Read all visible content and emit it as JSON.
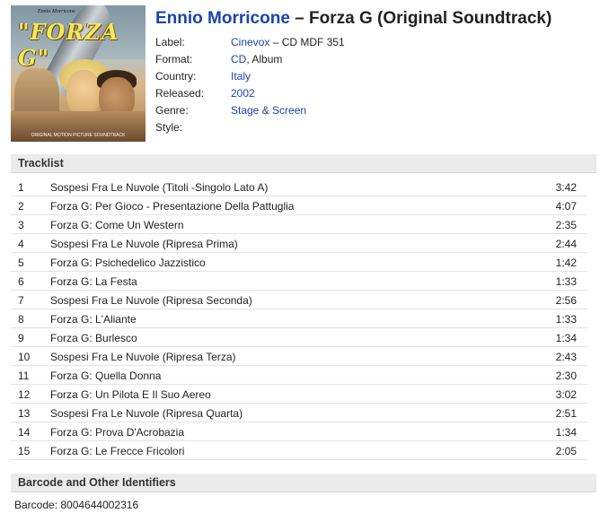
{
  "cover": {
    "artist_text": "Ennio Morricone",
    "title_text": "\"FORZA G\"",
    "caption_text": "ORIGINAL MOTION PICTURE SOUNDTRACK"
  },
  "release": {
    "artist": "Ennio Morricone",
    "separator": " – ",
    "title": "Forza G (Original Soundtrack)"
  },
  "meta": {
    "label_label": "Label:",
    "label_link": "Cinevox",
    "label_catalog": " – CD MDF 351",
    "format_label": "Format:",
    "format_link": "CD",
    "format_rest": ", Album",
    "country_label": "Country:",
    "country_value": "Italy",
    "released_label": "Released:",
    "released_value": "2002",
    "genre_label": "Genre:",
    "genre_value": "Stage & Screen",
    "style_label": "Style:"
  },
  "tracklist": {
    "heading": "Tracklist",
    "tracks": [
      {
        "pos": "1",
        "title": "Sospesi Fra Le Nuvole (Titoli -Singolo Lato A)",
        "duration": "3:42"
      },
      {
        "pos": "2",
        "title": "Forza G: Per Gioco - Presentazione Della Pattuglia",
        "duration": "4:07"
      },
      {
        "pos": "3",
        "title": "Forza G: Come Un Western",
        "duration": "2:35"
      },
      {
        "pos": "4",
        "title": "Sospesi Fra Le Nuvole (Ripresa Prima)",
        "duration": "2:44"
      },
      {
        "pos": "5",
        "title": "Forza G: Psichedelico Jazzistico",
        "duration": "1:42"
      },
      {
        "pos": "6",
        "title": "Forza G: La Festa",
        "duration": "1:33"
      },
      {
        "pos": "7",
        "title": "Sospesi Fra Le Nuvole (Ripresa Seconda)",
        "duration": "2:56"
      },
      {
        "pos": "8",
        "title": "Forza G: L'Aliante",
        "duration": "1:33"
      },
      {
        "pos": "9",
        "title": "Forza G: Burlesco",
        "duration": "1:34"
      },
      {
        "pos": "10",
        "title": "Sospesi Fra Le Nuvole (Ripresa Terza)",
        "duration": "2:43"
      },
      {
        "pos": "11",
        "title": "Forza G: Quella Donna",
        "duration": "2:30"
      },
      {
        "pos": "12",
        "title": "Forza G: Un Pilota E Il Suo Aereo",
        "duration": "3:02"
      },
      {
        "pos": "13",
        "title": "Sospesi Fra Le Nuvole (Ripresa Quarta)",
        "duration": "2:51"
      },
      {
        "pos": "14",
        "title": "Forza G: Prova D'Acrobazia",
        "duration": "1:34"
      },
      {
        "pos": "15",
        "title": "Forza G: Le Frecce Fricolori",
        "duration": "2:05"
      }
    ]
  },
  "identifiers": {
    "heading": "Barcode and Other Identifiers",
    "barcode_line": "Barcode: 8004644002316"
  },
  "colors": {
    "link": "#1a44aa",
    "section_bg": "#ebebeb",
    "row_divider": "#e3e3e3"
  }
}
